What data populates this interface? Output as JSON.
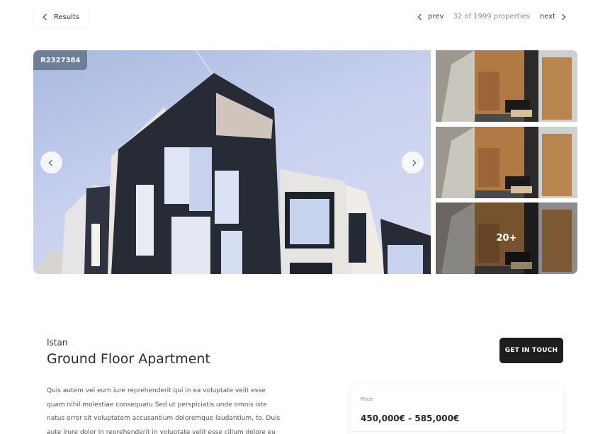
{
  "nav": {
    "back_label": "Results",
    "prev_label": "prev",
    "position_text": "32 of 1999 properties",
    "next_label": "next"
  },
  "gallery": {
    "ref_code": "R2327384",
    "more_count": "20+"
  },
  "listing": {
    "city": "Istan",
    "title": "Ground Floor Apartment",
    "cta_label": "GET IN TOUCH",
    "description": "Quis autem vel eum iure reprehenderit qui in ea voluptate velit esse quam nihil molestiae consequatu Sed ut perspiciatis unde omnis iste natus error sit voluptatem accusantium doloremque laudantium, to. Duis aute irure dolor in reprehenderit in voluptate velit esse cillum dolore eu fugiat nulla pariatu. Sed"
  },
  "price": {
    "label": "Price",
    "value": "450,000€ - 585,000€"
  }
}
